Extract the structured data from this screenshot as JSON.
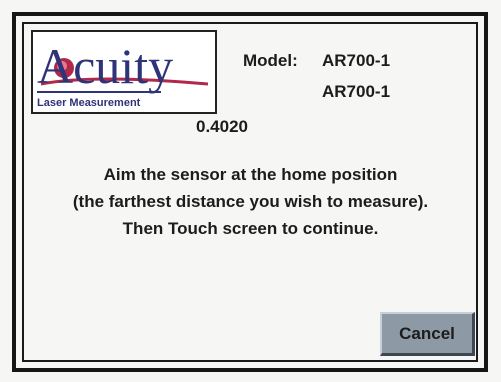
{
  "logo": {
    "brand_name": "Acuity",
    "tagline": "Laser Measurement"
  },
  "model": {
    "label": "Model:",
    "values": [
      "AR700-1",
      "AR700-1"
    ]
  },
  "reading": {
    "value": "0.4020"
  },
  "instructions": {
    "lines": [
      "Aim the sensor at the home position",
      "(the farthest distance you wish to measure).",
      "Then Touch screen to continue."
    ]
  },
  "buttons": {
    "cancel_label": "Cancel"
  },
  "colors": {
    "background": "#f6f6f4",
    "frame": "#161616",
    "button_face": "#8d9aa6",
    "logo_text": "#2f3377",
    "logo_swoosh": "#b0284a"
  },
  "icons": {
    "logo": "acuity-logo-icon"
  }
}
